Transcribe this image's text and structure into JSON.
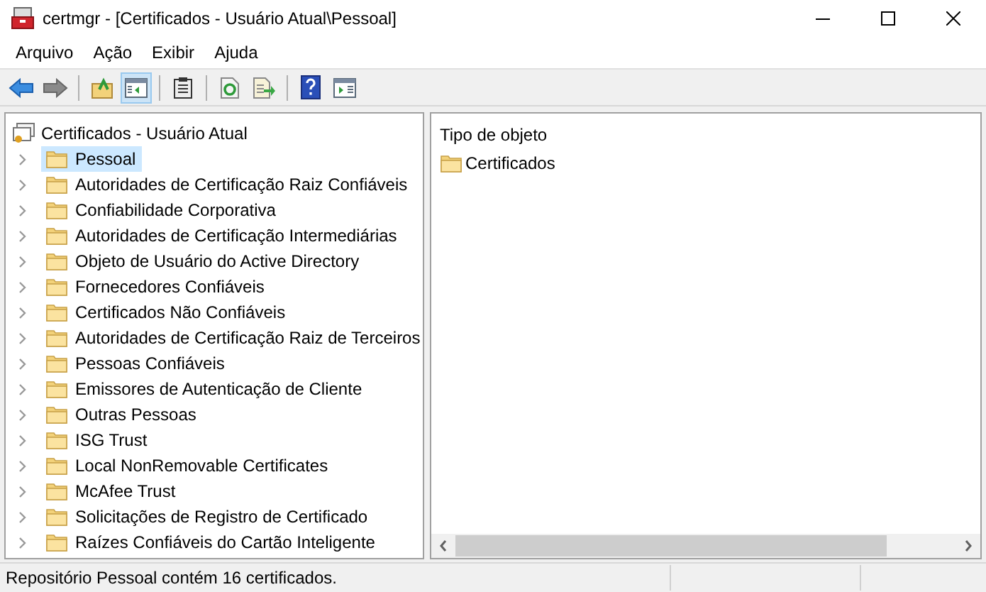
{
  "window": {
    "title": "certmgr - [Certificados - Usuário Atual\\Pessoal]"
  },
  "menu": [
    "Arquivo",
    "Ação",
    "Exibir",
    "Ajuda"
  ],
  "toolbar": [
    {
      "kind": "back",
      "pressed": false
    },
    {
      "kind": "forward",
      "pressed": false
    },
    {
      "kind": "sep"
    },
    {
      "kind": "up",
      "pressed": false
    },
    {
      "kind": "tree",
      "pressed": true
    },
    {
      "kind": "sep"
    },
    {
      "kind": "list",
      "pressed": false
    },
    {
      "kind": "sep"
    },
    {
      "kind": "refresh",
      "pressed": false
    },
    {
      "kind": "export",
      "pressed": false
    },
    {
      "kind": "sep"
    },
    {
      "kind": "help",
      "pressed": false
    },
    {
      "kind": "pane",
      "pressed": false
    }
  ],
  "tree": {
    "root": "Certificados - Usuário Atual",
    "children": [
      {
        "label": "Pessoal",
        "selected": true
      },
      {
        "label": "Autoridades de Certificação Raiz Confiáveis",
        "selected": false
      },
      {
        "label": "Confiabilidade Corporativa",
        "selected": false
      },
      {
        "label": "Autoridades de Certificação Intermediárias",
        "selected": false
      },
      {
        "label": "Objeto de Usuário do Active Directory",
        "selected": false
      },
      {
        "label": "Fornecedores Confiáveis",
        "selected": false
      },
      {
        "label": "Certificados Não Confiáveis",
        "selected": false
      },
      {
        "label": "Autoridades de Certificação Raiz de Terceiros",
        "selected": false
      },
      {
        "label": "Pessoas Confiáveis",
        "selected": false
      },
      {
        "label": "Emissores de Autenticação de Cliente",
        "selected": false
      },
      {
        "label": "Outras Pessoas",
        "selected": false
      },
      {
        "label": "ISG Trust",
        "selected": false
      },
      {
        "label": "Local NonRemovable Certificates",
        "selected": false
      },
      {
        "label": "McAfee Trust",
        "selected": false
      },
      {
        "label": "Solicitações de Registro de Certificado",
        "selected": false
      },
      {
        "label": "Raízes Confiáveis do Cartão Inteligente",
        "selected": false
      }
    ]
  },
  "list": {
    "column": "Tipo de objeto",
    "items": [
      "Certificados"
    ]
  },
  "status_bar": "Repositório Pessoal contém 16 certificados."
}
